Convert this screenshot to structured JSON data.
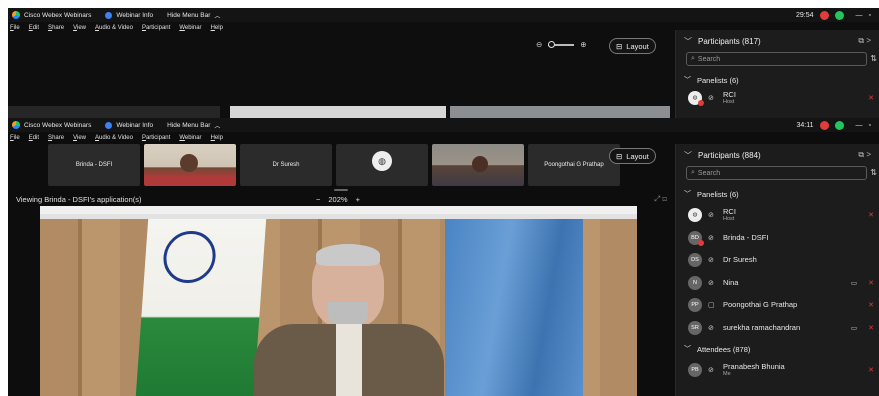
{
  "window_top": {
    "app_title": "Cisco Webex Webinars",
    "info": "Webinar Info",
    "hide_menu": "Hide Menu Bar",
    "clock": "29:54",
    "menu": [
      "File",
      "Edit",
      "Share",
      "View",
      "Audio & Video",
      "Participant",
      "Webinar",
      "Help"
    ],
    "layout_label": "Layout",
    "participants_header": "Participants (817)",
    "search_placeholder": "Search",
    "panelists_header": "Panelists (6)",
    "rci_name": "RCI",
    "rci_role": "Host"
  },
  "window_bottom": {
    "app_title": "Cisco Webex Webinars",
    "info": "Webinar Info",
    "hide_menu": "Hide Menu Bar",
    "clock": "34:11",
    "menu": [
      "File",
      "Edit",
      "Share",
      "View",
      "Audio & Video",
      "Participant",
      "Webinar",
      "Help"
    ],
    "layout_label": "Layout",
    "tiles": [
      "Brinda - DSFI",
      "",
      "Dr Suresh",
      "",
      "",
      "Poongothai G Prathap"
    ],
    "viewing_label": "Viewing Brinda - DSFI's application(s)",
    "zoom_level": "202%",
    "zoom_minus": "−",
    "zoom_plus": "+",
    "participants_header": "Participants (884)",
    "search_placeholder": "Search",
    "panelists_header": "Panelists (6)",
    "panelists": [
      {
        "initials": "",
        "name": "RCI",
        "role": "Host"
      },
      {
        "initials": "BD",
        "name": "Brinda - DSFI",
        "role": ""
      },
      {
        "initials": "DS",
        "name": "Dr Suresh",
        "role": ""
      },
      {
        "initials": "N",
        "name": "Nina",
        "role": ""
      },
      {
        "initials": "PP",
        "name": "Poongothai G Prathap",
        "role": ""
      },
      {
        "initials": "SR",
        "name": "surekha ramachandran",
        "role": ""
      }
    ],
    "attendees_header": "Attendees (878)",
    "attendee": {
      "initials": "PB",
      "name": "Pranabesh Bhunia",
      "role": "Me"
    }
  },
  "colors": {
    "recording": "#e23b3b",
    "accent_green": "#22c55e",
    "webex_blue": "#1a8cff"
  }
}
